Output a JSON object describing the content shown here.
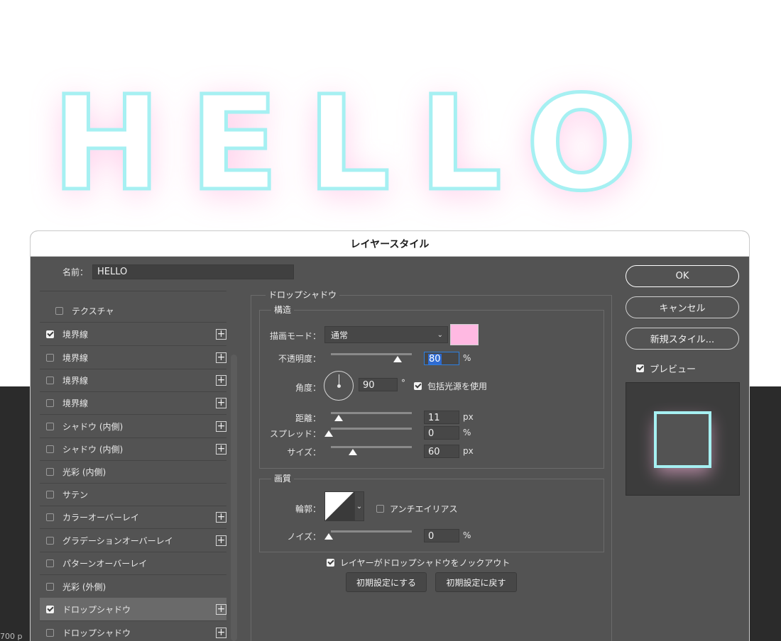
{
  "canvas": {
    "hello_text": "HELLO",
    "zoom_readout": "700 p"
  },
  "dialog": {
    "title": "レイヤースタイル",
    "name_label": "名前：",
    "name_value": "HELLO"
  },
  "styles_list": [
    {
      "label": "テクスチャ",
      "checked": false,
      "plus": false,
      "indent": true
    },
    {
      "label": "境界線",
      "checked": true,
      "plus": true
    },
    {
      "label": "境界線",
      "checked": false,
      "plus": true
    },
    {
      "label": "境界線",
      "checked": false,
      "plus": true
    },
    {
      "label": "境界線",
      "checked": false,
      "plus": true
    },
    {
      "label": "シャドウ (内側)",
      "checked": false,
      "plus": true
    },
    {
      "label": "シャドウ (内側)",
      "checked": false,
      "plus": true
    },
    {
      "label": "光彩 (内側)",
      "checked": false,
      "plus": false
    },
    {
      "label": "サテン",
      "checked": false,
      "plus": false
    },
    {
      "label": "カラーオーバーレイ",
      "checked": false,
      "plus": true
    },
    {
      "label": "グラデーションオーバーレイ",
      "checked": false,
      "plus": true
    },
    {
      "label": "パターンオーバーレイ",
      "checked": false,
      "plus": false
    },
    {
      "label": "光彩 (外側)",
      "checked": false,
      "plus": false
    },
    {
      "label": "ドロップシャドウ",
      "checked": true,
      "plus": true,
      "selected": true
    },
    {
      "label": "ドロップシャドウ",
      "checked": false,
      "plus": true
    }
  ],
  "drop_shadow": {
    "section_title": "ドロップシャドウ",
    "structure": {
      "title": "構造",
      "blend_mode_label": "描画モード：",
      "blend_mode_value": "通常",
      "shadow_color": "#ffb9e2",
      "opacity_label": "不透明度：",
      "opacity_value": "80",
      "opacity_unit": "%",
      "opacity_level": 0.8,
      "angle_label": "角度：",
      "angle_value": "90",
      "angle_unit": "°",
      "global_light_label": "包括光源を使用",
      "global_light_checked": true,
      "distance_label": "距離：",
      "distance_value": "11",
      "distance_unit": "px",
      "spread_label": "スプレッド：",
      "spread_value": "0",
      "spread_unit": "%",
      "size_label": "サイズ：",
      "size_value": "60",
      "size_unit": "px"
    },
    "quality": {
      "title": "画質",
      "contour_label": "輪郭：",
      "antialias_label": "アンチエイリアス",
      "antialias_checked": false,
      "noise_label": "ノイズ：",
      "noise_value": "0",
      "noise_unit": "%"
    },
    "knockout_label": "レイヤーがドロップシャドウをノックアウト",
    "knockout_checked": true,
    "make_default_button": "初期設定にする",
    "reset_default_button": "初期設定に戻す"
  },
  "right_buttons": {
    "ok": "OK",
    "cancel": "キャンセル",
    "new_style": "新規スタイル...",
    "preview_label": "プレビュー",
    "preview_checked": true
  },
  "colors": {
    "stroke_cyan": "#a6f0f2",
    "glow_pink": "#ffb9e2",
    "dialog_bg": "#535353"
  }
}
